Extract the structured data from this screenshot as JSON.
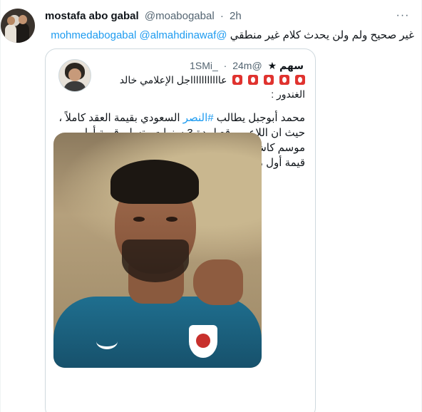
{
  "tweet": {
    "author_name": "mostafa abo gabal",
    "author_handle": "@moabogabal",
    "separator": "·",
    "time": "2h",
    "more_label": "···",
    "reply_to": [
      "@almahdinawaf",
      "@mohmedabogabal"
    ],
    "text": "غير صحيح ولم ولن يحدث كلام غير منطقي"
  },
  "quoted": {
    "author_name": "سهم ★",
    "author_handle": "@1SMi_",
    "separator": "·",
    "time": "24m",
    "line1": "عاااااااااااجل الإعلامي خالد",
    "line2": "الغندور :",
    "body_before": "محمد أبوجبل يطالب ",
    "hashtag": "#النصر",
    "body_after": " السعودي بقيمة العقد كاملاً ، حيث ان اللاعب وقع لمدة 3 سنوات وتسلم قيمة أول موسم كاش كاملاً ، لكن النصر أبلغه بأنه لا يريد استرداد قيمة أول موسم مقابل فسخ العقد واللاعب رفض!!",
    "badge_count": 5
  },
  "icons": {
    "more": "more-horizontal-icon",
    "badge": "red-alert-emoji-icon"
  },
  "colors": {
    "link": "#1d9bf0",
    "secondary_text": "#536471",
    "border": "#cfd9de",
    "badge": "#e0332f"
  }
}
